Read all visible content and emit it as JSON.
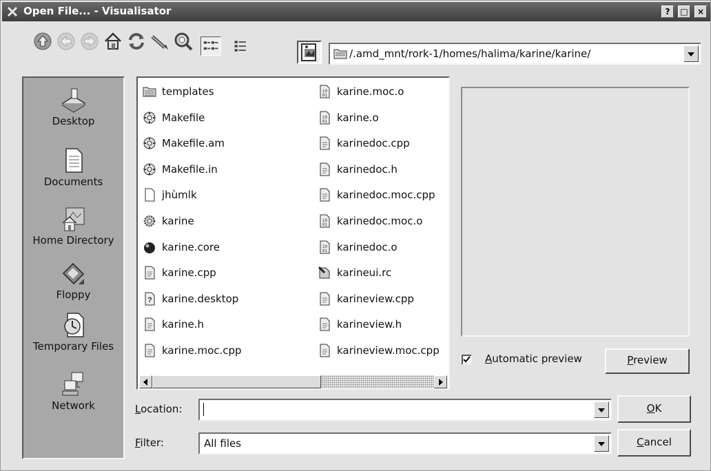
{
  "window": {
    "title": "Open File... - Visualisator",
    "controls": {
      "help": "?",
      "maximize": "□",
      "close": "×"
    }
  },
  "toolbar": {
    "buttons": [
      "up-icon",
      "back-icon",
      "forward-icon",
      "home-icon",
      "reload-icon",
      "new-folder-icon",
      "configure-icon",
      "icon-view-icon",
      "detail-view-icon",
      "preview-toggle-icon"
    ],
    "path": "/.amd_mnt/rork-1/homes/halima/karine/karine/"
  },
  "sidebar": {
    "items": [
      {
        "label": "Desktop",
        "icon": "desktop-icon"
      },
      {
        "label": "Documents",
        "icon": "documents-icon"
      },
      {
        "label": "Home Directory",
        "icon": "home-directory-icon"
      },
      {
        "label": "Floppy",
        "icon": "floppy-icon"
      },
      {
        "label": "Temporary Files",
        "icon": "temporary-files-icon"
      },
      {
        "label": "Network",
        "icon": "network-icon"
      }
    ]
  },
  "files": {
    "column1": [
      {
        "name": "templates",
        "icon": "folder-icon"
      },
      {
        "name": "Makefile",
        "icon": "makefile-icon"
      },
      {
        "name": "Makefile.am",
        "icon": "makefile-icon"
      },
      {
        "name": "Makefile.in",
        "icon": "makefile-icon"
      },
      {
        "name": "jhùmlk",
        "icon": "empty-file-icon"
      },
      {
        "name": "karine",
        "icon": "executable-icon"
      },
      {
        "name": "karine.core",
        "icon": "core-file-icon"
      },
      {
        "name": "karine.cpp",
        "icon": "source-file-icon"
      },
      {
        "name": "karine.desktop",
        "icon": "desktop-file-icon"
      },
      {
        "name": "karine.h",
        "icon": "source-file-icon"
      },
      {
        "name": "karine.moc.cpp",
        "icon": "source-file-icon"
      }
    ],
    "column2": [
      {
        "name": "karine.moc.o",
        "icon": "object-file-icon"
      },
      {
        "name": "karine.o",
        "icon": "object-file-icon"
      },
      {
        "name": "karinedoc.cpp",
        "icon": "source-file-icon"
      },
      {
        "name": "karinedoc.h",
        "icon": "source-file-icon"
      },
      {
        "name": "karinedoc.moc.cpp",
        "icon": "source-file-icon"
      },
      {
        "name": "karinedoc.moc.o",
        "icon": "object-file-icon"
      },
      {
        "name": "karinedoc.o",
        "icon": "object-file-icon"
      },
      {
        "name": "karineui.rc",
        "icon": "rc-file-icon"
      },
      {
        "name": "karineview.cpp",
        "icon": "source-file-icon"
      },
      {
        "name": "karineview.h",
        "icon": "source-file-icon"
      },
      {
        "name": "karineview.moc.cpp",
        "icon": "source-file-icon"
      }
    ]
  },
  "preview": {
    "automatic_label": "Automatic preview",
    "automatic_checked": true,
    "preview_button": "Preview"
  },
  "location": {
    "label": "Location:",
    "value": ""
  },
  "filter": {
    "label": "Filter:",
    "value": "All files"
  },
  "buttons": {
    "ok": "OK",
    "cancel": "Cancel"
  }
}
